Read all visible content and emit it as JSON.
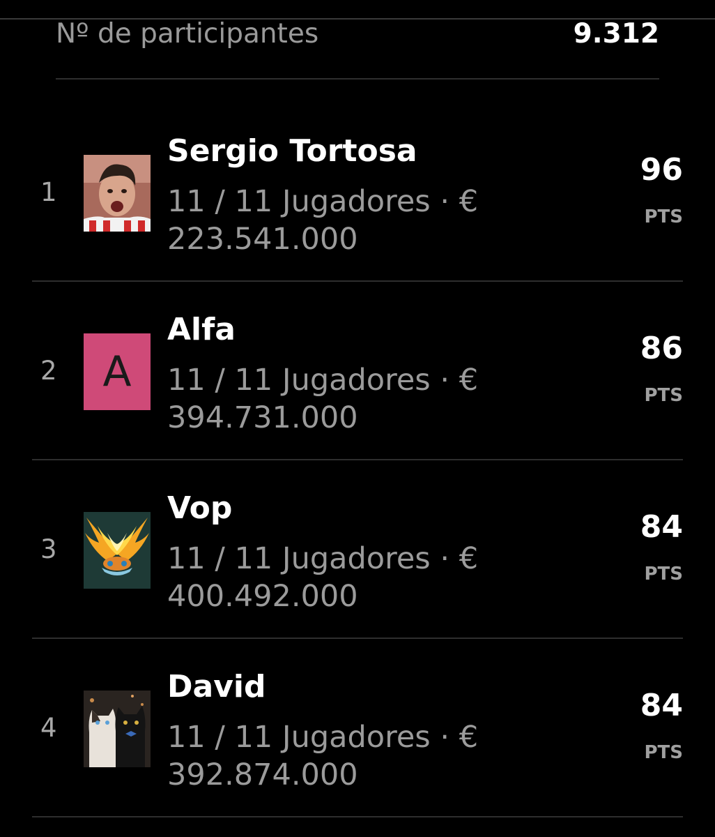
{
  "participants": {
    "label": "Nº de participantes",
    "value": "9.312"
  },
  "ranking": [
    {
      "position": "1",
      "name": "Sergio Tortosa",
      "players": "11 / 11 Jugadores · €",
      "value": "223.541.000",
      "points": "96",
      "points_unit": "PTS",
      "avatar": "player-photo"
    },
    {
      "position": "2",
      "name": "Alfa",
      "players": "11 / 11 Jugadores · €",
      "value": "394.731.000",
      "points": "86",
      "points_unit": "PTS",
      "avatar": "letter",
      "avatar_letter": "A",
      "avatar_color": "#cf4a78"
    },
    {
      "position": "3",
      "name": "Vop",
      "players": "11 / 11 Jugadores · €",
      "value": "400.492.000",
      "points": "84",
      "points_unit": "PTS",
      "avatar": "flame-creature-image"
    },
    {
      "position": "4",
      "name": "David",
      "players": "11 / 11 Jugadores · €",
      "value": "392.874.000",
      "points": "84",
      "points_unit": "PTS",
      "avatar": "cats-image"
    }
  ]
}
